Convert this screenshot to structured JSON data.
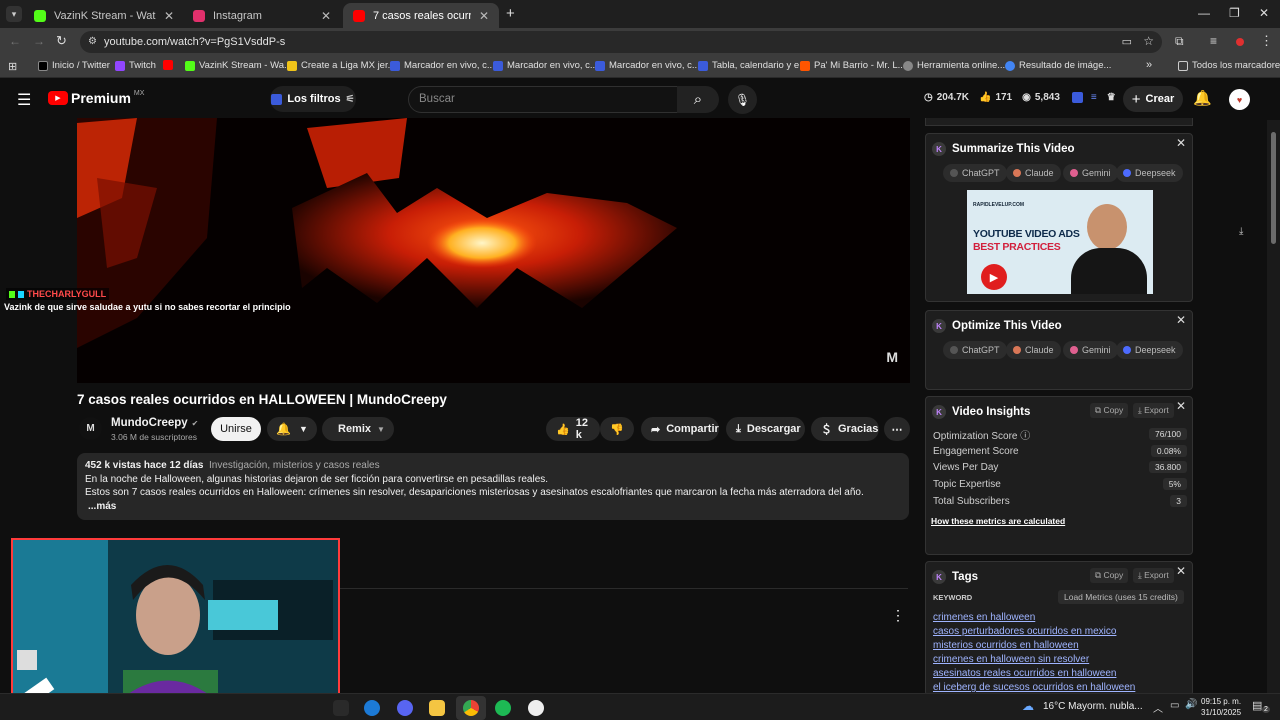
{
  "tabs": [
    {
      "title": "VazinK Stream - Watch Live on",
      "active": false,
      "color": "#53fc18"
    },
    {
      "title": "Instagram",
      "active": false,
      "color": "#e1306c"
    },
    {
      "title": "7 casos reales ocurridos en HA",
      "active": true,
      "color": "#ff0000"
    }
  ],
  "url": "youtube.com/watch?v=PgS1VsddP-s",
  "bookmarks": [
    {
      "label": "Inicio / Twitter",
      "color": "#000000"
    },
    {
      "label": "Twitch",
      "color": "#9146ff"
    },
    {
      "label": "",
      "color": "#ff0000"
    },
    {
      "label": "VazinK Stream - Wa...",
      "color": "#53fc18"
    },
    {
      "label": "Create a Liga MX jer...",
      "color": "#f0c419"
    },
    {
      "label": "Marcador en vivo, c...",
      "color": "#3b5bdb"
    },
    {
      "label": "Marcador en vivo, c...",
      "color": "#3b5bdb"
    },
    {
      "label": "Marcador en vivo, c...",
      "color": "#3b5bdb"
    },
    {
      "label": "Tabla, calendario y e...",
      "color": "#3b5bdb"
    },
    {
      "label": "Pa' Mi Barrio - Mr. L...",
      "color": "#ff5500"
    },
    {
      "label": "Herramienta online...",
      "color": "#888888"
    },
    {
      "label": "Resultado de imáge...",
      "color": "#4285f4"
    }
  ],
  "all_bookmarks": "Todos los marcadores",
  "yt": {
    "logo": "Premium",
    "region": "MX",
    "filters": "Los filtros",
    "search_placeholder": "Buscar",
    "stat_views": "204.7K",
    "stat_likes": "171",
    "stat_count": "5,843",
    "create": "Crear"
  },
  "chat": {
    "user": "THECHARLYGULL",
    "message": "Vazink de que sirve saludae a yutu si no sabes recortar el principio"
  },
  "video": {
    "title": "7 casos reales ocurridos en HALLOWEEN | MundoCreepy",
    "channel": "MundoCreepy",
    "subs": "3.06 M de suscriptores",
    "join": "Unirse",
    "remix": "Remix",
    "likes": "12 k",
    "share": "Compartir",
    "download": "Descargar",
    "thanks": "Gracias",
    "views_date": "452 k vistas  hace 12 días",
    "hashtags": "Investigación, misterios y casos reales",
    "desc1": "En la noche de Halloween, algunas historias dejaron de ser ficción para convertirse en pesadillas reales.",
    "desc2": "Estos son 7 casos reales ocurridos en Halloween: crímenes sin resolver, desapariciones misteriosas y asesinatos escalofriantes que marcaron la fecha más aterradora del año.",
    "more": "...más"
  },
  "summarize": {
    "title": "Summarize This Video",
    "ais": [
      "ChatGPT",
      "Claude",
      "Gemini",
      "Deepseek"
    ],
    "thumb_brand": "RAPIDLEVELUP.COM",
    "thumb_line1": "YOUTUBE VIDEO ADS",
    "thumb_line2": "BEST PRACTICES"
  },
  "optimize": {
    "title": "Optimize This Video",
    "ais": [
      "ChatGPT",
      "Claude",
      "Gemini",
      "Deepseek"
    ]
  },
  "insights": {
    "title": "Video Insights",
    "copy": "Copy",
    "export": "Export",
    "metrics": [
      {
        "label": "Optimization Score",
        "value": "76/100"
      },
      {
        "label": "Engagement Score",
        "value": "0.08%"
      },
      {
        "label": "Views Per Day",
        "value": "36.800"
      },
      {
        "label": "Topic Expertise",
        "value": "5%"
      },
      {
        "label": "Total Subscribers",
        "value": "3"
      }
    ],
    "how": "How these metrics are calculated"
  },
  "tags": {
    "title": "Tags",
    "copy": "Copy",
    "export": "Export",
    "keyword": "KEYWORD",
    "load": "Load Metrics (uses 15 credits)",
    "items": [
      "crimenes en halloween",
      "casos perturbadores ocurridos en mexico",
      "misterios ocurridos en halloween",
      "crimenes en halloween sin resolver",
      "asesinatos reales ocurridos en halloween",
      "el iceberg de sucesos ocurridos en halloween"
    ]
  },
  "taskbar": {
    "weather": "16°C  Mayorm. nubla...",
    "time": "09:15 p. m.",
    "date": "31/10/2025",
    "notif": "2"
  }
}
